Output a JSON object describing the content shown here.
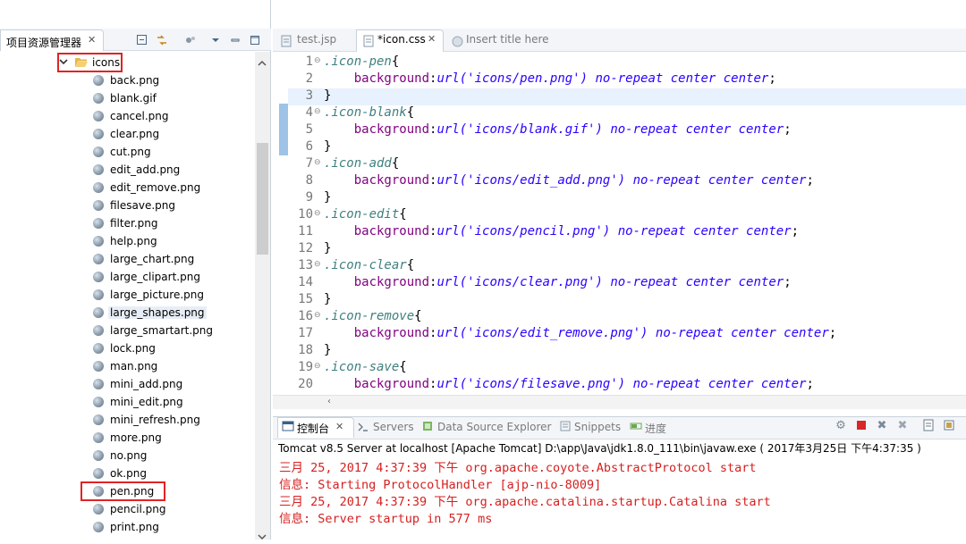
{
  "explorer": {
    "title": "项目资源管理器",
    "close_glyph": "✕",
    "folder": "icons",
    "files": [
      "back.png",
      "blank.gif",
      "cancel.png",
      "clear.png",
      "cut.png",
      "edit_add.png",
      "edit_remove.png",
      "filesave.png",
      "filter.png",
      "help.png",
      "large_chart.png",
      "large_clipart.png",
      "large_picture.png",
      "large_shapes.png",
      "large_smartart.png",
      "lock.png",
      "man.png",
      "mini_add.png",
      "mini_edit.png",
      "mini_refresh.png",
      "more.png",
      "no.png",
      "ok.png",
      "pen.png",
      "pencil.png",
      "print.png"
    ]
  },
  "editor": {
    "tabs": [
      "test.jsp",
      "*icon.css",
      "Insert title here"
    ],
    "lines": [
      {
        "n": "1",
        "fold": "⊖",
        "parts": [
          {
            "t": ".icon-pen",
            "c": "sel"
          },
          {
            "t": "{",
            "c": ""
          }
        ]
      },
      {
        "n": "2",
        "fold": "",
        "parts": [
          {
            "t": "    ",
            "c": ""
          },
          {
            "t": "background",
            "c": "prop"
          },
          {
            "t": ":",
            "c": ""
          },
          {
            "t": "url('icons/pen.png') no-repeat center center",
            "c": "val"
          },
          {
            "t": ";",
            "c": ""
          }
        ]
      },
      {
        "n": "3",
        "fold": "",
        "parts": [
          {
            "t": "}",
            "c": ""
          }
        ]
      },
      {
        "n": "4",
        "fold": "⊖",
        "parts": [
          {
            "t": ".icon-blank",
            "c": "sel"
          },
          {
            "t": "{",
            "c": ""
          }
        ]
      },
      {
        "n": "5",
        "fold": "",
        "parts": [
          {
            "t": "    ",
            "c": ""
          },
          {
            "t": "background",
            "c": "prop"
          },
          {
            "t": ":",
            "c": ""
          },
          {
            "t": "url('icons/blank.gif') no-repeat center center",
            "c": "val"
          },
          {
            "t": ";",
            "c": ""
          }
        ]
      },
      {
        "n": "6",
        "fold": "",
        "parts": [
          {
            "t": "}",
            "c": ""
          }
        ]
      },
      {
        "n": "7",
        "fold": "⊖",
        "parts": [
          {
            "t": ".icon-add",
            "c": "sel"
          },
          {
            "t": "{",
            "c": ""
          }
        ]
      },
      {
        "n": "8",
        "fold": "",
        "parts": [
          {
            "t": "    ",
            "c": ""
          },
          {
            "t": "background",
            "c": "prop"
          },
          {
            "t": ":",
            "c": ""
          },
          {
            "t": "url('icons/edit_add.png') no-repeat center center",
            "c": "val"
          },
          {
            "t": ";",
            "c": ""
          }
        ]
      },
      {
        "n": "9",
        "fold": "",
        "parts": [
          {
            "t": "}",
            "c": ""
          }
        ]
      },
      {
        "n": "10",
        "fold": "⊖",
        "parts": [
          {
            "t": ".icon-edit",
            "c": "sel"
          },
          {
            "t": "{",
            "c": ""
          }
        ]
      },
      {
        "n": "11",
        "fold": "",
        "parts": [
          {
            "t": "    ",
            "c": ""
          },
          {
            "t": "background",
            "c": "prop"
          },
          {
            "t": ":",
            "c": ""
          },
          {
            "t": "url('icons/pencil.png') no-repeat center center",
            "c": "val"
          },
          {
            "t": ";",
            "c": ""
          }
        ]
      },
      {
        "n": "12",
        "fold": "",
        "parts": [
          {
            "t": "}",
            "c": ""
          }
        ]
      },
      {
        "n": "13",
        "fold": "⊖",
        "parts": [
          {
            "t": ".icon-clear",
            "c": "sel"
          },
          {
            "t": "{",
            "c": ""
          }
        ]
      },
      {
        "n": "14",
        "fold": "",
        "parts": [
          {
            "t": "    ",
            "c": ""
          },
          {
            "t": "background",
            "c": "prop"
          },
          {
            "t": ":",
            "c": ""
          },
          {
            "t": "url('icons/clear.png') no-repeat center center",
            "c": "val"
          },
          {
            "t": ";",
            "c": ""
          }
        ]
      },
      {
        "n": "15",
        "fold": "",
        "parts": [
          {
            "t": "}",
            "c": ""
          }
        ]
      },
      {
        "n": "16",
        "fold": "⊖",
        "parts": [
          {
            "t": ".icon-remove",
            "c": "sel"
          },
          {
            "t": "{",
            "c": ""
          }
        ]
      },
      {
        "n": "17",
        "fold": "",
        "parts": [
          {
            "t": "    ",
            "c": ""
          },
          {
            "t": "background",
            "c": "prop"
          },
          {
            "t": ":",
            "c": ""
          },
          {
            "t": "url('icons/edit_remove.png') no-repeat center center",
            "c": "val"
          },
          {
            "t": ";",
            "c": ""
          }
        ]
      },
      {
        "n": "18",
        "fold": "",
        "parts": [
          {
            "t": "}",
            "c": ""
          }
        ]
      },
      {
        "n": "19",
        "fold": "⊖",
        "parts": [
          {
            "t": ".icon-save",
            "c": "sel"
          },
          {
            "t": "{",
            "c": ""
          }
        ]
      },
      {
        "n": "20",
        "fold": "",
        "parts": [
          {
            "t": "    ",
            "c": ""
          },
          {
            "t": "background",
            "c": "prop"
          },
          {
            "t": ":",
            "c": ""
          },
          {
            "t": "url('icons/filesave.png') no-repeat center center",
            "c": "val"
          },
          {
            "t": ";",
            "c": ""
          }
        ]
      }
    ]
  },
  "console": {
    "tabs": [
      "控制台",
      "Servers",
      "Data Source Explorer",
      "Snippets",
      "进度"
    ],
    "title": "Tomcat v8.5 Server at localhost [Apache Tomcat] D:\\app\\Java\\jdk1.8.0_111\\bin\\javaw.exe ( 2017年3月25日 下午4:37:35 )",
    "lines": [
      "三月 25, 2017 4:37:39 下午 org.apache.coyote.AbstractProtocol start",
      "信息: Starting ProtocolHandler [ajp-nio-8009]",
      "三月 25, 2017 4:37:39 下午 org.apache.catalina.startup.Catalina start",
      "信息: Server startup in 577 ms"
    ]
  },
  "colors": {
    "highlight_box": "#e02424",
    "console_text": "#d62020"
  }
}
